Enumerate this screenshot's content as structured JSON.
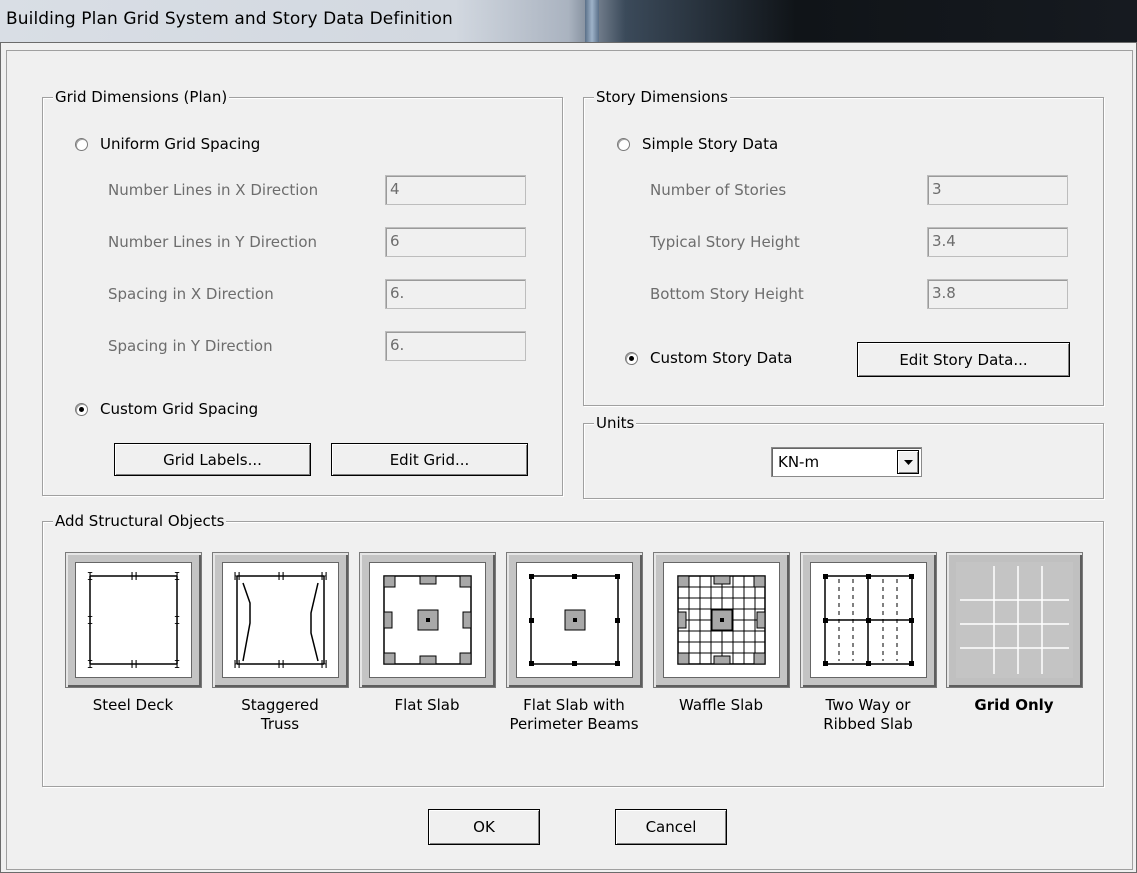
{
  "window": {
    "title": "Building Plan Grid System and Story Data Definition"
  },
  "grid_dimensions": {
    "legend": "Grid Dimensions (Plan)",
    "uniform_label": "Uniform Grid Spacing",
    "fields": [
      {
        "label": "Number Lines in X Direction",
        "value": "4"
      },
      {
        "label": "Number Lines in Y Direction",
        "value": "6"
      },
      {
        "label": "Spacing in X Direction",
        "value": "6."
      },
      {
        "label": "Spacing in Y Direction",
        "value": "6."
      }
    ],
    "custom_label": "Custom Grid Spacing",
    "grid_labels_button": "Grid Labels...",
    "edit_grid_button": "Edit Grid..."
  },
  "story_dimensions": {
    "legend": "Story Dimensions",
    "simple_label": "Simple Story Data",
    "fields": [
      {
        "label": "Number of Stories",
        "value": "3"
      },
      {
        "label": "Typical Story Height",
        "value": "3.4"
      },
      {
        "label": "Bottom Story Height",
        "value": "3.8"
      }
    ],
    "custom_label": "Custom Story Data",
    "edit_story_button": "Edit Story Data..."
  },
  "units": {
    "legend": "Units",
    "selected": "KN-m"
  },
  "structural_objects": {
    "legend": "Add Structural Objects",
    "items": [
      {
        "line1": "Steel Deck",
        "line2": ""
      },
      {
        "line1": "Staggered",
        "line2": "Truss"
      },
      {
        "line1": "Flat Slab",
        "line2": ""
      },
      {
        "line1": "Flat Slab with",
        "line2": "Perimeter Beams"
      },
      {
        "line1": "Waffle Slab",
        "line2": ""
      },
      {
        "line1": "Two Way or",
        "line2": "Ribbed Slab"
      },
      {
        "line1": "Grid Only",
        "line2": ""
      }
    ]
  },
  "buttons": {
    "ok": "OK",
    "cancel": "Cancel"
  }
}
